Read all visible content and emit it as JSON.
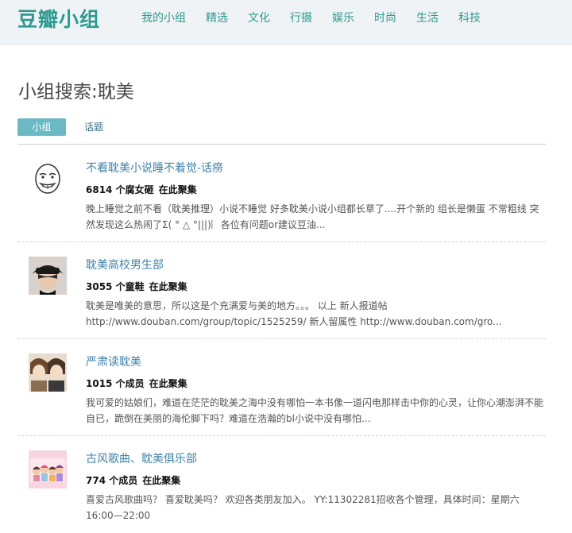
{
  "header": {
    "logo": "豆瓣小组",
    "nav": [
      "我的小组",
      "精选",
      "文化",
      "行摄",
      "娱乐",
      "时尚",
      "生活",
      "科技"
    ]
  },
  "page_title": "小组搜索:耽美",
  "tabs": {
    "active": "小组",
    "other": "话题"
  },
  "results": [
    {
      "title": "不看耽美小说睡不着觉-话痨",
      "count": "6814 个腐女砸",
      "here": "在此聚集",
      "desc": "晚上睡觉之前不看（耽美推理）小说不睡觉 好多耽美小说小组都长草了....开个新的 组长是懒蛋 不常粗线 突然发现这么热闹了Σ( ° △ °|||)︴各位有问题or建议豆油...",
      "avatar": "rage-face-avatar"
    },
    {
      "title": "耽美高校男生部",
      "count": "3055 个童鞋",
      "here": "在此聚集",
      "desc": "耽美是唯美的意思，所以这是个充满爱与美的地方。。。 以上 新人报道帖 http://www.douban.com/group/topic/1525259/ 新人留属性 http://www.douban.com/gro...",
      "avatar": "hat-boy-avatar"
    },
    {
      "title": "严肃读耽美",
      "count": "1015 个成员",
      "here": "在此聚集",
      "desc": "我可爱的姑娘们，难道在茫茫的耽美之海中没有哪怕一本书像一道闪电那样击中你的心灵，让你心潮澎湃不能自已，跪倒在美丽的海伦脚下吗？难道在浩瀚的bl小说中没有哪怕...",
      "avatar": "anime-pair-avatar"
    },
    {
      "title": "古风歌曲、耽美俱乐部",
      "count": "774 个成员",
      "here": "在此聚集",
      "desc": "喜爱古风歌曲吗？ 喜爱耽美吗？ 欢迎各类朋友加入。 YY:11302281招收各个管理，具体时间：星期六 16:00—22:00",
      "avatar": "pink-cartoon-avatar"
    }
  ]
}
